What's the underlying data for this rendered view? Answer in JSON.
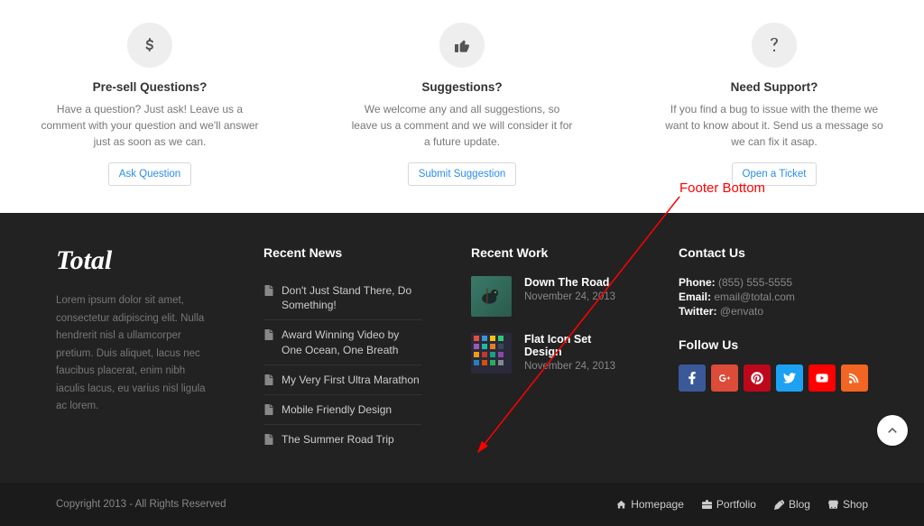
{
  "features": [
    {
      "title": "Pre-sell Questions?",
      "desc": "Have a question? Just ask! Leave us a comment with your question and we'll answer just as soon as we can.",
      "btn": "Ask Question"
    },
    {
      "title": "Suggestions?",
      "desc": "We welcome any and all suggestions, so leave us a comment and we will consider it for a future update.",
      "btn": "Submit Suggestion"
    },
    {
      "title": "Need Support?",
      "desc": "If you find a bug to issue with the theme we want to know about it. Send us a message so we can fix it asap.",
      "btn": "Open a Ticket"
    }
  ],
  "annotation": {
    "label": "Footer Bottom"
  },
  "footer": {
    "brand": "Total",
    "about": "Lorem ipsum dolor sit amet, consectetur adipiscing elit. Nulla hendrerit nisl a ullamcorper pretium. Duis aliquet, lacus nec faucibus placerat, enim nibh iaculis lacus, eu varius nisl ligula ac lorem.",
    "news_title": "Recent News",
    "news": [
      "Don't Just Stand There, Do Something!",
      "Award Winning Video by One Ocean, One Breath",
      "My Very First Ultra Marathon",
      "Mobile Friendly Design",
      "The Summer Road Trip"
    ],
    "work_title": "Recent Work",
    "work": [
      {
        "title": "Down The Road",
        "date": "November 24, 2013"
      },
      {
        "title": "Flat Icon Set Design",
        "date": "November 24, 2013"
      }
    ],
    "contact_title": "Contact Us",
    "contact": {
      "phone_label": "Phone:",
      "phone": "(855) 555-5555",
      "email_label": "Email:",
      "email": "email@total.com",
      "twitter_label": "Twitter:",
      "twitter": "@envato"
    },
    "follow_title": "Follow Us"
  },
  "footer_bottom": {
    "copyright": "Copyright 2013 - All Rights Reserved",
    "nav": [
      "Homepage",
      "Portfolio",
      "Blog",
      "Shop"
    ]
  }
}
